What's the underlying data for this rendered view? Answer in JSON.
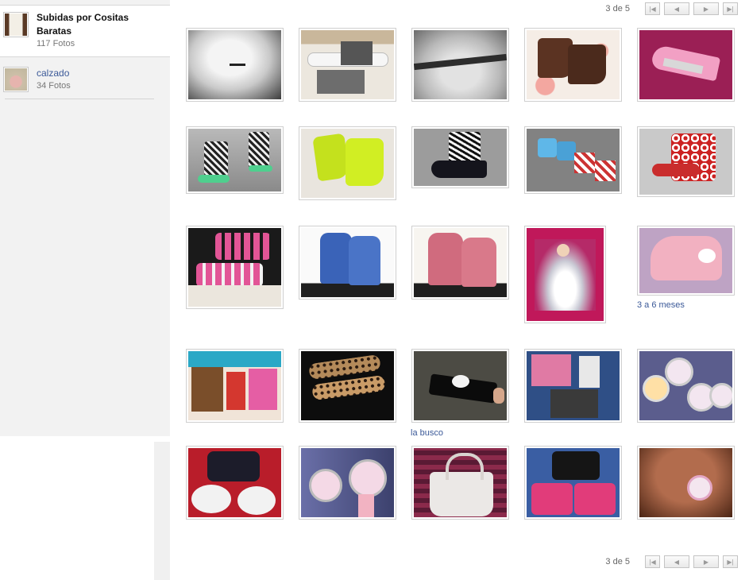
{
  "sidebar": {
    "current_album": {
      "title": "Subidas por Cositas Baratas",
      "count": "117 Fotos"
    },
    "other_album": {
      "title": "calzado",
      "count": "34 Fotos"
    }
  },
  "pager": {
    "top_text": "3 de 5",
    "bottom_text": "3 de 5",
    "first_icon": "first-page-icon",
    "prev_icon": "previous-page-icon",
    "next_icon": "next-page-icon",
    "last_icon": "last-page-icon"
  },
  "captions": {
    "p15": "3 a 6 meses",
    "p18": "la busco"
  },
  "photos": [
    "Foto 1",
    "Foto 2",
    "Foto 3",
    "Foto 4",
    "Foto 5",
    "Foto 6",
    "Foto 7",
    "Foto 8",
    "Foto 9",
    "Foto 10",
    "Foto 11",
    "Foto 12",
    "Foto 13",
    "Foto 14",
    "Foto 15",
    "Foto 16",
    "Foto 17",
    "Foto 18",
    "Foto 19",
    "Foto 20",
    "Foto 21",
    "Foto 22",
    "Foto 23",
    "Foto 24",
    "Foto 25"
  ],
  "colors": {
    "link": "#3b5998",
    "sidebar_bg": "#f2f2f2"
  }
}
